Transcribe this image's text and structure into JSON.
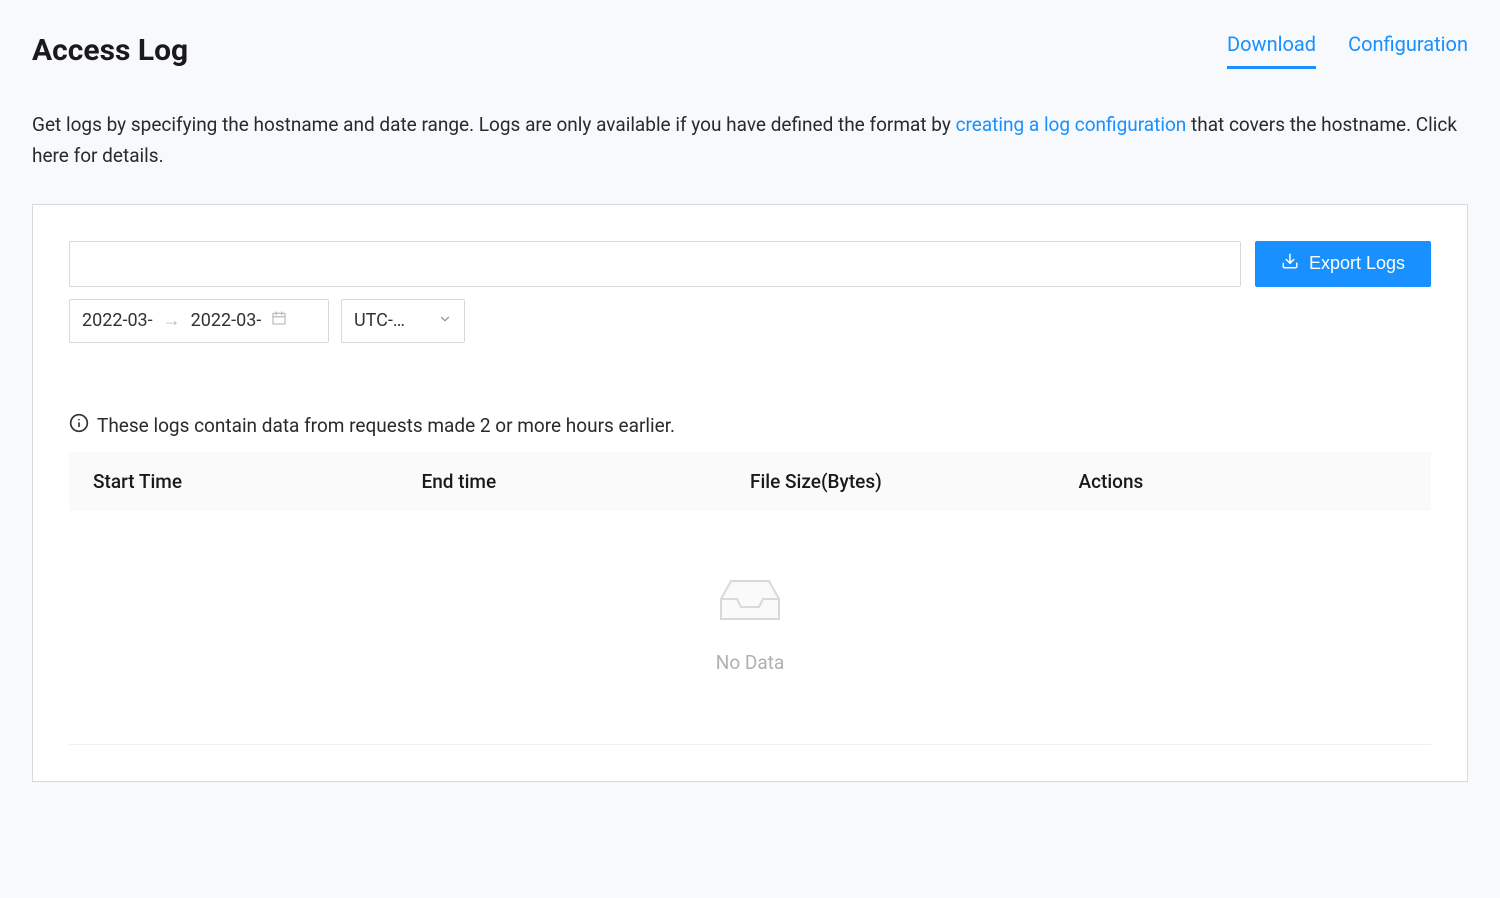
{
  "header": {
    "title": "Access Log",
    "tabs": {
      "download": "Download",
      "configuration": "Configuration"
    }
  },
  "description": {
    "part1": "Get logs by specifying the hostname and date range. Logs are only available if you have defined the format by ",
    "link": "creating a log configuration",
    "part2": " that covers the hostname. Click here for details."
  },
  "controls": {
    "hostname_value": "",
    "export_button": "Export Logs",
    "date_from": "2022-03-",
    "date_to": "2022-03-",
    "timezone": "UTC-…"
  },
  "info_notice": "These logs contain data from requests made 2 or more hours earlier.",
  "table": {
    "columns": {
      "start_time": "Start Time",
      "end_time": "End time",
      "file_size": "File Size(Bytes)",
      "actions": "Actions"
    },
    "empty_text": "No Data"
  }
}
